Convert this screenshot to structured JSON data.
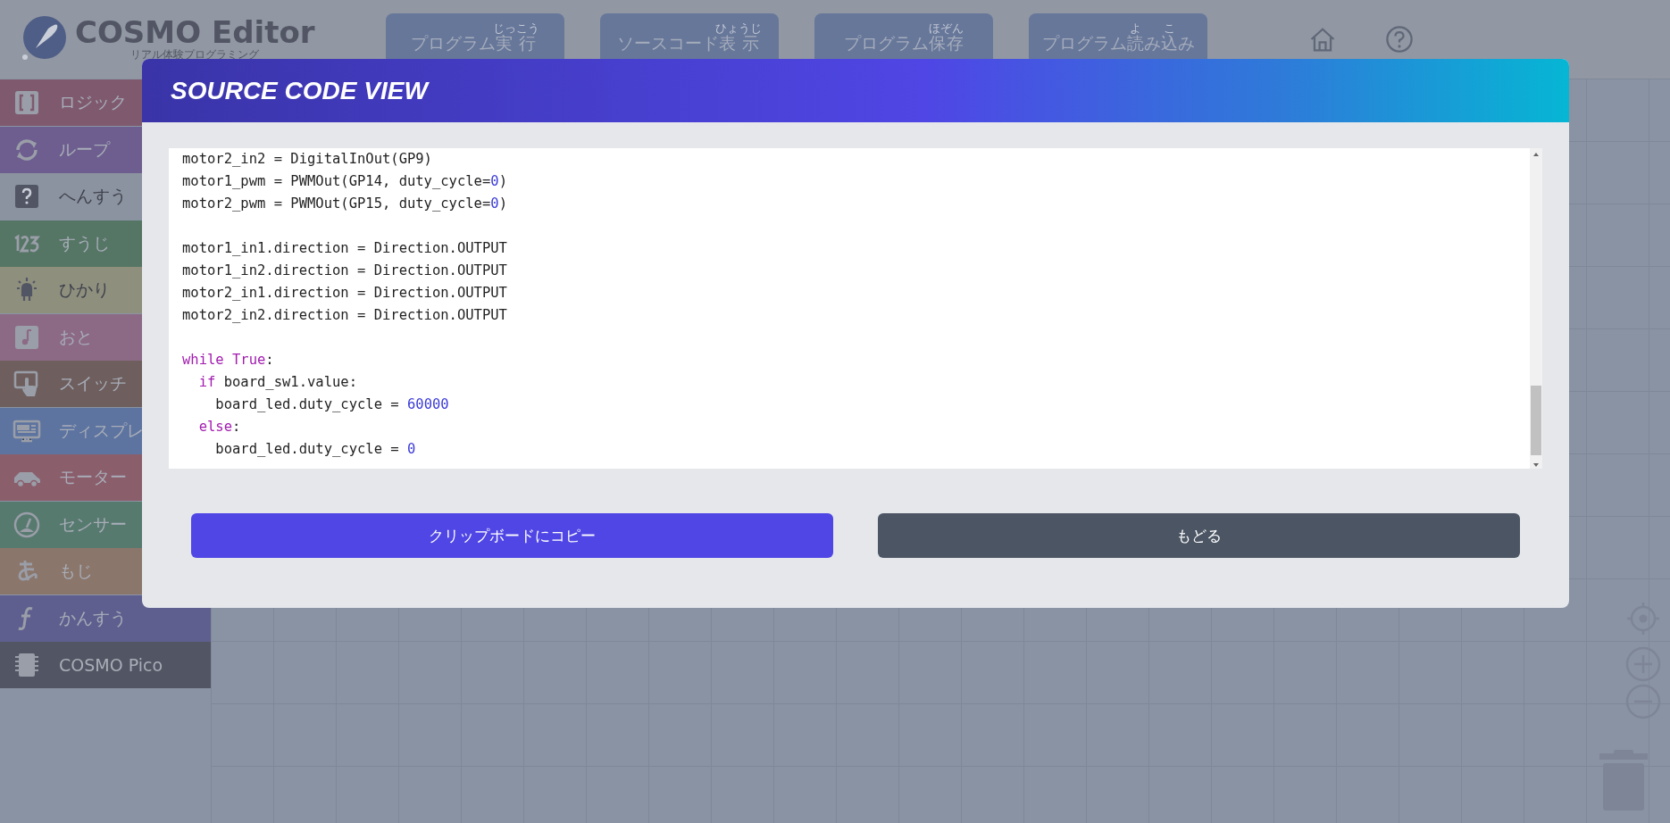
{
  "header": {
    "logo": "COSMO Editor",
    "tagline": "リアル体験プログラミング",
    "buttons": [
      {
        "parts": [
          {
            "text": "プログラム"
          },
          {
            "text": "実行",
            "ruby": "じっこう"
          }
        ]
      },
      {
        "parts": [
          {
            "text": "ソースコード"
          },
          {
            "text": "表示",
            "ruby": "ひょうじ"
          }
        ]
      },
      {
        "parts": [
          {
            "text": "プログラム"
          },
          {
            "text": "保存",
            "ruby": "ほぞん"
          }
        ]
      },
      {
        "parts": [
          {
            "text": "プログラム"
          },
          {
            "text": "読",
            "ruby": "よ"
          },
          {
            "text": "み"
          },
          {
            "text": "込",
            "ruby": "こ"
          },
          {
            "text": "み"
          }
        ]
      }
    ]
  },
  "sidebar": {
    "items": [
      {
        "label": "ロジック",
        "color": "#7f5a6f"
      },
      {
        "label": "ループ",
        "color": "#6d5e8f"
      },
      {
        "label": "へんすう",
        "color": "#8c93a0"
      },
      {
        "label": "すうじ",
        "color": "#557565"
      },
      {
        "label": "ひかり",
        "color": "#8f8f7e"
      },
      {
        "label": "おと",
        "color": "#8c6a86"
      },
      {
        "label": "スイッチ",
        "color": "#6e5f5e"
      },
      {
        "label": "ディスプレ",
        "color": "#5d74a0"
      },
      {
        "label": "モーター",
        "color": "#8b5e6c"
      },
      {
        "label": "センサー",
        "color": "#577a6f"
      },
      {
        "label": "もじ",
        "color": "#8b766b"
      },
      {
        "label": "かんすう",
        "color": "#5f5f8f"
      },
      {
        "label": "COSMO Pico",
        "color": "#525664"
      }
    ]
  },
  "dialog": {
    "title": "SOURCE CODE VIEW",
    "code": [
      [
        [
          {
            "t": "motor2_in2 = DigitalInOut(GP9)",
            "kind": "plain"
          }
        ],
        [
          {
            "t": "motor1_pwm = PWMOut(GP14, duty_cycle=",
            "kind": "plain"
          },
          {
            "t": "0",
            "kind": "number"
          },
          {
            "t": ")",
            "kind": "plain"
          }
        ],
        [
          {
            "t": "motor2_pwm = PWMOut(GP15, duty_cycle=",
            "kind": "plain"
          },
          {
            "t": "0",
            "kind": "number"
          },
          {
            "t": ")",
            "kind": "plain"
          }
        ]
      ],
      [
        [
          {
            "t": "motor1_in1.direction = Direction.OUTPUT",
            "kind": "plain"
          }
        ],
        [
          {
            "t": "motor1_in2.direction = Direction.OUTPUT",
            "kind": "plain"
          }
        ],
        [
          {
            "t": "motor2_in1.direction = Direction.OUTPUT",
            "kind": "plain"
          }
        ],
        [
          {
            "t": "motor2_in2.direction = Direction.OUTPUT",
            "kind": "plain"
          }
        ]
      ],
      [
        [
          {
            "t": "while True",
            "kind": "keyword"
          },
          {
            "t": ":",
            "kind": "plain"
          }
        ],
        [
          {
            "t": "  if",
            "kind": "keyword"
          },
          {
            "t": " board_sw1.value:",
            "kind": "plain"
          }
        ],
        [
          {
            "t": "    board_led.duty_cycle = ",
            "kind": "plain"
          },
          {
            "t": "60000",
            "kind": "number"
          }
        ],
        [
          {
            "t": "  else",
            "kind": "keyword"
          },
          {
            "t": ":",
            "kind": "plain"
          }
        ],
        [
          {
            "t": "    board_led.duty_cycle = ",
            "kind": "plain"
          },
          {
            "t": "0",
            "kind": "number"
          }
        ]
      ]
    ],
    "buttons": [
      {
        "label": "クリップボードにコピー",
        "kind": "primary"
      },
      {
        "label": "もどる",
        "kind": "secondary"
      }
    ]
  }
}
